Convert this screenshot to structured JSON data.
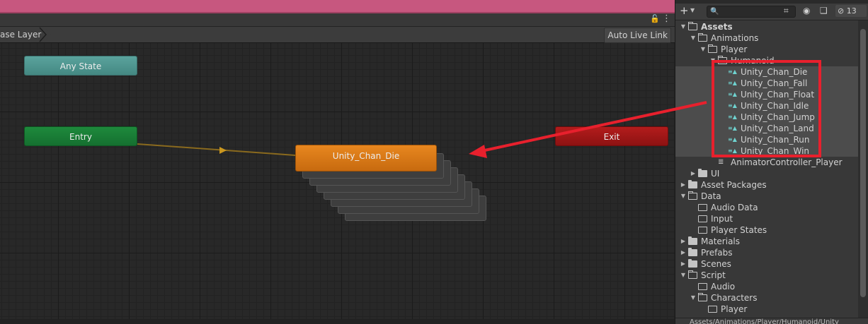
{
  "animator": {
    "breadcrumb": "ase Layer",
    "auto_live_link": "Auto Live Link",
    "lock_icon": "lock-icon",
    "menu_icon": "more-menu-icon",
    "nodes": {
      "any_state": "Any State",
      "entry": "Entry",
      "exit": "Exit",
      "state": "Unity_Chan_Die"
    },
    "colors": {
      "any_state": "#4f968f",
      "entry": "#1a7e37",
      "exit": "#a01616",
      "state": "#e07c17",
      "transition": "#8a6a1e",
      "highlight": "#e8202d"
    }
  },
  "project": {
    "toolbar": {
      "add_icon": "plus-icon",
      "search_placeholder": "",
      "hidden_count": "13"
    },
    "tree": [
      {
        "label": "Assets",
        "kind": "open",
        "expanded": true,
        "bold": true
      },
      {
        "label": "Animations",
        "kind": "open",
        "expanded": true
      },
      {
        "label": "Player",
        "kind": "open",
        "expanded": true
      },
      {
        "label": "Humanoid",
        "kind": "open",
        "expanded": true
      },
      {
        "label": "Unity_Chan_Die",
        "kind": "anim",
        "selected": true
      },
      {
        "label": "Unity_Chan_Fall",
        "kind": "anim",
        "selected": true
      },
      {
        "label": "Unity_Chan_Float",
        "kind": "anim",
        "selected": true
      },
      {
        "label": "Unity_Chan_Idle",
        "kind": "anim",
        "selected": true
      },
      {
        "label": "Unity_Chan_Jump",
        "kind": "anim",
        "selected": true
      },
      {
        "label": "Unity_Chan_Land",
        "kind": "anim",
        "selected": true
      },
      {
        "label": "Unity_Chan_Run",
        "kind": "anim",
        "selected": true
      },
      {
        "label": "Unity_Chan_Win",
        "kind": "anim",
        "selected": true
      },
      {
        "label": "AnimatorController_Player",
        "kind": "controller"
      },
      {
        "label": "UI",
        "kind": "closed",
        "expanded": false
      },
      {
        "label": "Asset Packages",
        "kind": "closed",
        "expanded": false
      },
      {
        "label": "Data",
        "kind": "open",
        "expanded": true
      },
      {
        "label": "Audio Data",
        "kind": "empty"
      },
      {
        "label": "Input",
        "kind": "empty"
      },
      {
        "label": "Player States",
        "kind": "empty"
      },
      {
        "label": "Materials",
        "kind": "closed",
        "expanded": false
      },
      {
        "label": "Prefabs",
        "kind": "closed",
        "expanded": false
      },
      {
        "label": "Scenes",
        "kind": "closed",
        "expanded": false
      },
      {
        "label": "Script",
        "kind": "open",
        "expanded": true
      },
      {
        "label": "Audio",
        "kind": "empty"
      },
      {
        "label": "Characters",
        "kind": "open",
        "expanded": true
      },
      {
        "label": "Player",
        "kind": "empty"
      }
    ],
    "path": "Assets/Animations/Player/Humanoid/Unity"
  }
}
